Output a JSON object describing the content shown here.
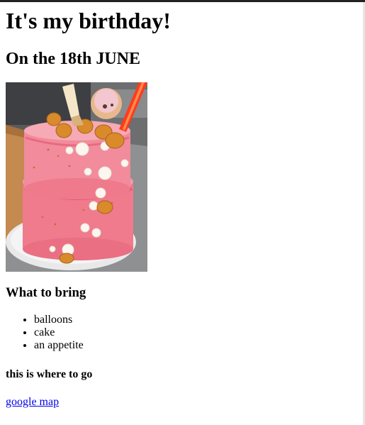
{
  "heading": "It's my birthday!",
  "date_heading": "On the 18th JUNE",
  "image": {
    "alt": "birthday cake",
    "icon": "cake-photo"
  },
  "bring": {
    "title": "What to bring",
    "items": [
      "balloons",
      "cake",
      "an appetite"
    ]
  },
  "where": {
    "title": "this is where to go"
  },
  "map_link": {
    "label": "google map"
  }
}
